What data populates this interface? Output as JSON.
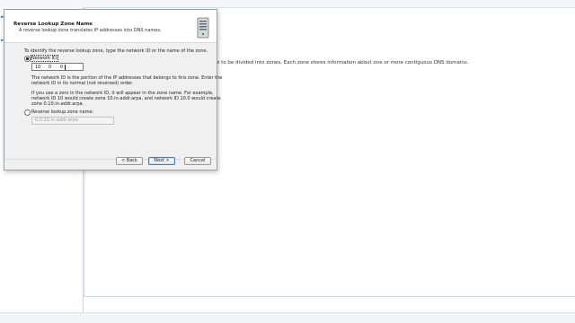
{
  "dialog": {
    "title": "Reverse Lookup Zone Name",
    "subtitle": "A reverse lookup zone translates IP addresses into DNS names.",
    "instruction": "To identify the reverse lookup zone, type the network ID or the name of the zone.",
    "network_id_option": {
      "label": "Network ID:",
      "selected": true,
      "octets": [
        "10",
        "0",
        "0",
        ""
      ]
    },
    "network_id_help": [
      "The network ID is the portion of the IP addresses that belongs to this zone. Enter the",
      "network ID in its normal (not reversed) order."
    ],
    "zero_help": [
      "If you use a zero in the network ID, it will appear in the zone name. For example,",
      "network ID 10 would create zone 10.in-addr.arpa, and network ID 10.0 would create",
      "zone 0.10.in-addr.arpa."
    ],
    "zone_name_option": {
      "label": "Reverse lookup zone name:",
      "selected": false,
      "value": "0.0.10.in-addr.arpa"
    },
    "buttons": {
      "back": "< Back",
      "next": "Next >",
      "cancel": "Cancel"
    },
    "icon": "server-icon"
  },
  "background": {
    "info_text": "ce to be divided into zones. Each zone stores information about one or more contiguous DNS domains."
  }
}
